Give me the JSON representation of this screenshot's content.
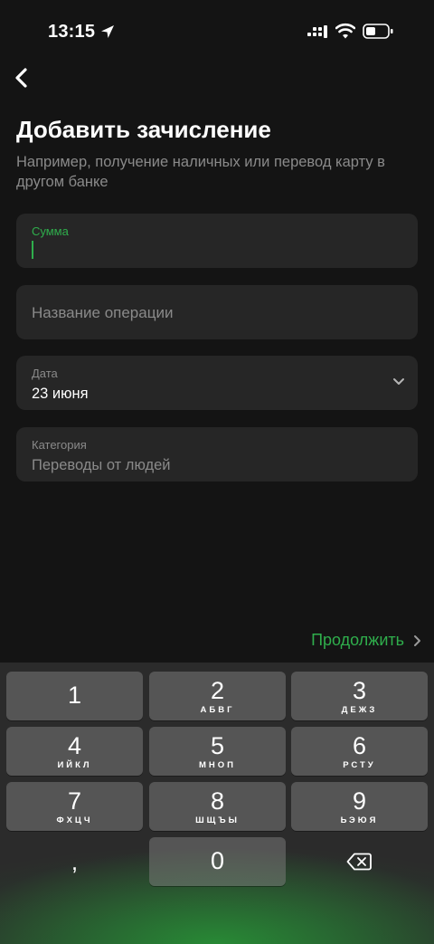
{
  "status_bar": {
    "time": "13:15"
  },
  "header": {
    "title": "Добавить зачисление",
    "subtitle": "Например, получение наличных или перевод карту в другом банке"
  },
  "form": {
    "amount": {
      "label": "Сумма",
      "value": ""
    },
    "operation_name": {
      "placeholder": "Название операции"
    },
    "date": {
      "label": "Дата",
      "value": "23 июня"
    },
    "category": {
      "label": "Категория",
      "value": "Переводы от людей"
    }
  },
  "actions": {
    "continue_label": "Продолжить"
  },
  "colors": {
    "accent": "#2fae4c",
    "background": "#141414",
    "field": "#262626"
  },
  "keyboard": {
    "keys": [
      {
        "num": "1",
        "letters": ""
      },
      {
        "num": "2",
        "letters": "АБВГ"
      },
      {
        "num": "3",
        "letters": "ДЕЖЗ"
      },
      {
        "num": "4",
        "letters": "ИЙКЛ"
      },
      {
        "num": "5",
        "letters": "МНОП"
      },
      {
        "num": "6",
        "letters": "РСТУ"
      },
      {
        "num": "7",
        "letters": "ФХЦЧ"
      },
      {
        "num": "8",
        "letters": "ШЩЪЫ"
      },
      {
        "num": "9",
        "letters": "ЬЭЮЯ"
      },
      {
        "num": "0",
        "letters": ""
      }
    ],
    "comma": ",",
    "delete_icon": "backspace-icon"
  }
}
